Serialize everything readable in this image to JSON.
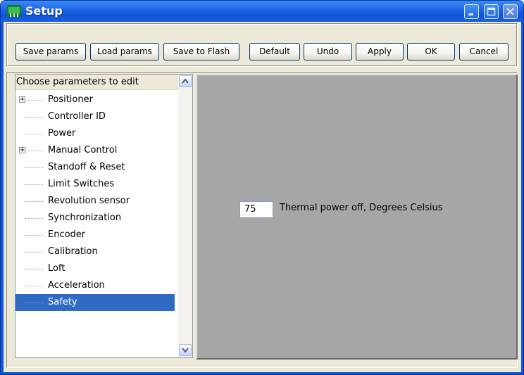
{
  "window": {
    "title": "Setup"
  },
  "toolbar": {
    "buttons": [
      "Save params",
      "Load params",
      "Save to Flash",
      "Default",
      "Undo",
      "Apply",
      "OK",
      "Cancel"
    ]
  },
  "tree": {
    "header": "Choose parameters to edit",
    "items": [
      {
        "label": "Positioner",
        "expandable": true
      },
      {
        "label": "Controller ID",
        "expandable": false
      },
      {
        "label": "Power",
        "expandable": false
      },
      {
        "label": "Manual Control",
        "expandable": true
      },
      {
        "label": "Standoff & Reset",
        "expandable": false
      },
      {
        "label": "Limit Switches",
        "expandable": false
      },
      {
        "label": "Revolution sensor",
        "expandable": false
      },
      {
        "label": "Synchronization",
        "expandable": false
      },
      {
        "label": "Encoder",
        "expandable": false
      },
      {
        "label": "Calibration",
        "expandable": false
      },
      {
        "label": "Loft",
        "expandable": false
      },
      {
        "label": "Acceleration",
        "expandable": false
      },
      {
        "label": "Safety",
        "expandable": false,
        "selected": true
      }
    ],
    "expander_symbol": "+"
  },
  "settings": {
    "thermal_value": "75",
    "thermal_label": "Thermal power off, Degrees Celsius"
  },
  "colors": {
    "selection": "#316ac5",
    "title_bar": "#0c54d6"
  }
}
